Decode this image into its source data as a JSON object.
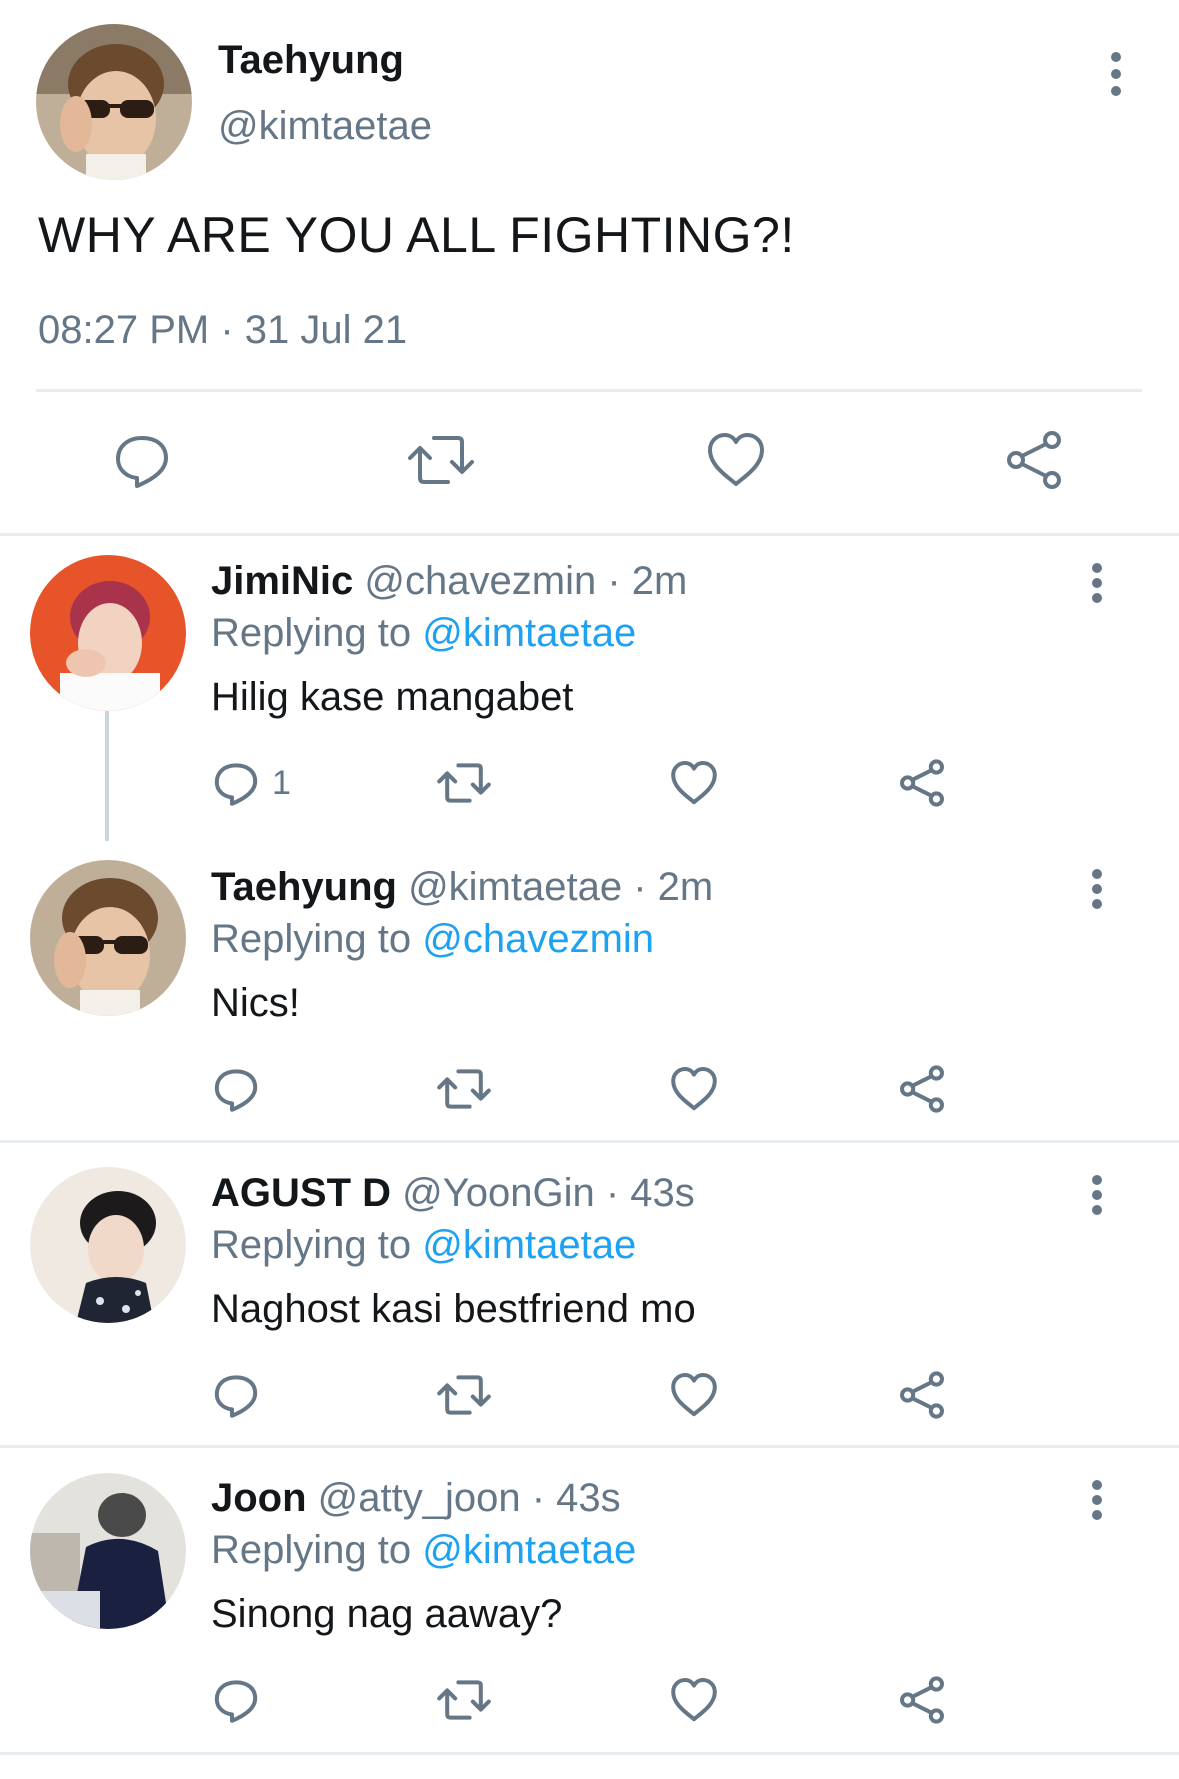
{
  "main_tweet": {
    "name": "Taehyung",
    "handle": "@kimtaetae",
    "text": "WHY ARE YOU ALL FIGHTING?!",
    "timestamp": "08:27 PM · 31 Jul 21",
    "avatar": "avatar-photo-icon",
    "actions": [
      "reply-icon",
      "retweet-icon",
      "like-icon",
      "share-icon"
    ]
  },
  "replies": [
    {
      "name": "JimiNic",
      "meta": "@chavezmin · 2m",
      "replying_label": "Replying to ",
      "replying_to": "@kimtaetae",
      "text": "Hilig kase mangabet",
      "reply_count": "1",
      "avatar_color": "#e8542a"
    },
    {
      "name": "Taehyung",
      "meta": "@kimtaetae · 2m",
      "replying_label": "Replying to ",
      "replying_to": "@chavezmin",
      "text": "Nics!",
      "reply_count": "",
      "avatar_color": "#9a7a52"
    },
    {
      "name": "AGUST D",
      "meta": "@YoonGin · 43s",
      "replying_label": "Replying to ",
      "replying_to": "@kimtaetae",
      "text": "Naghost kasi bestfriend mo",
      "reply_count": "",
      "avatar_color": "#efe9e2"
    },
    {
      "name": "Joon",
      "meta": "@atty_joon · 43s",
      "replying_label": "Replying to ",
      "replying_to": "@kimtaetae",
      "text": "Sinong nag aaway?",
      "reply_count": "",
      "avatar_color": "#2a2f3d"
    }
  ],
  "colors": {
    "accent": "#1da1f2",
    "secondary_text": "#657786",
    "divider": "#e6ecf0"
  }
}
